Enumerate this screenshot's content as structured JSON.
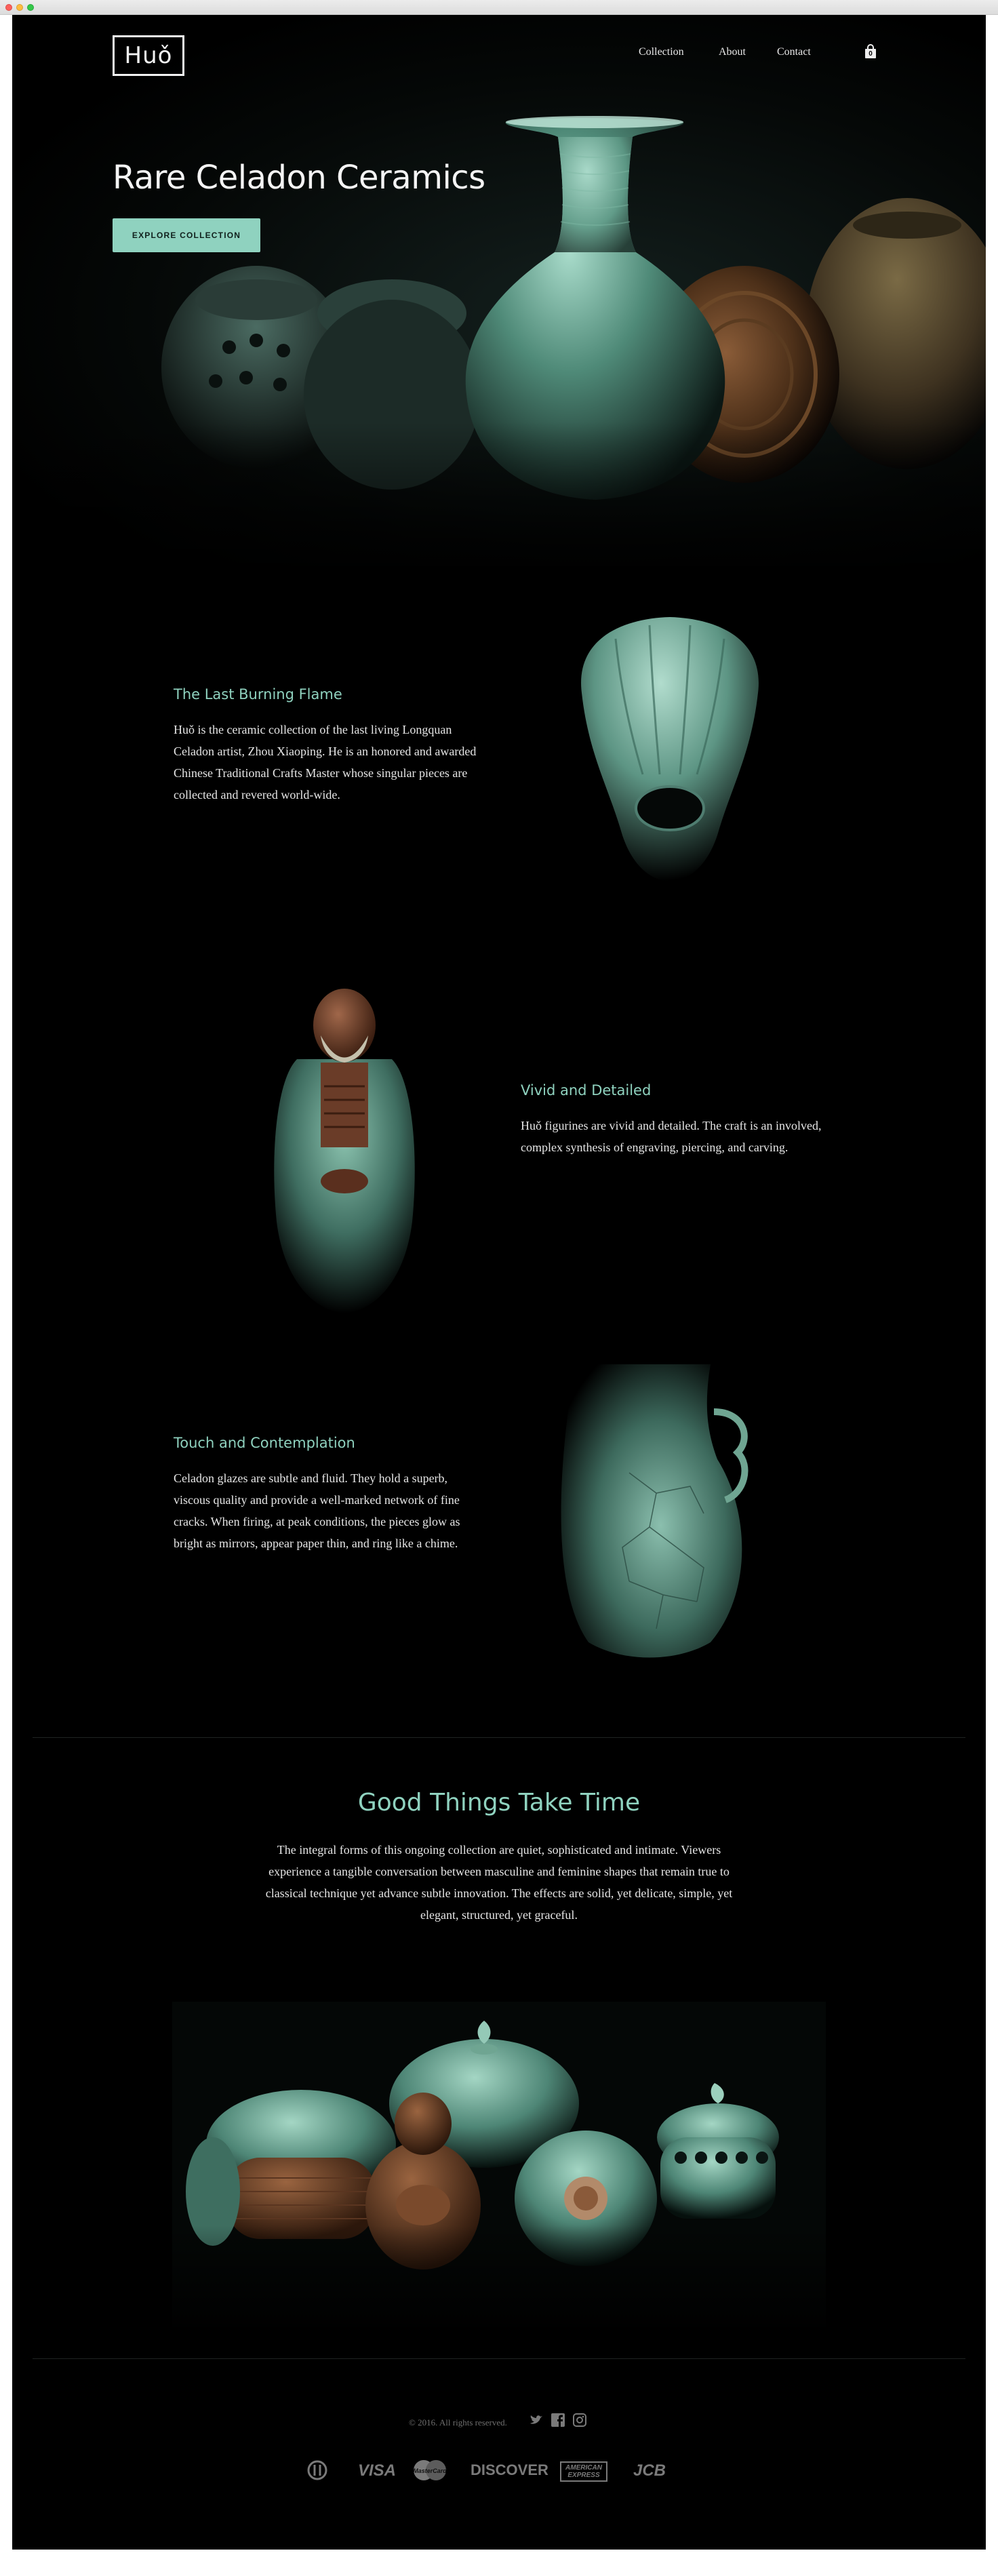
{
  "brand": {
    "logo": "Huǒ"
  },
  "nav": {
    "collection": "Collection",
    "about": "About",
    "contact": "Contact",
    "cart_count": "0"
  },
  "hero": {
    "title": "Rare Celadon Ceramics",
    "button": "EXPLORE COLLECTION"
  },
  "features": [
    {
      "title": "The Last Burning Flame",
      "text": "Huǒ is the ceramic collection of the last living Longquan Celadon artist, Zhou Xiaoping. He is an honored and awarded Chinese Traditional Crafts Master whose singular pieces are collected and revered world-wide."
    },
    {
      "title": "Vivid and Detailed",
      "text": "Huǒ figurines are vivid and detailed. The craft is an involved, complex synthesis of engraving, piercing, and carving."
    },
    {
      "title": "Touch and Contemplation",
      "text": "Celadon glazes are subtle and fluid. They hold a superb, viscous quality and provide a well-marked network of fine cracks. When firing, at peak conditions, the pieces glow as bright as mirrors, appear paper thin, and ring like a chime."
    }
  ],
  "good_things": {
    "title": "Good Things Take Time",
    "text": "The integral forms of this ongoing collection are quiet, sophisticated and intimate. Viewers experience a tangible conversation between masculine and feminine shapes that remain true to classical technique yet advance subtle innovation. The effects are solid, yet delicate, simple, yet elegant, structured, yet graceful."
  },
  "footer": {
    "copyright": "© 2016. All rights reserved.",
    "payments": [
      "Diners",
      "VISA",
      "MasterCard",
      "DISCOVER",
      "AMERICAN EXPRESS",
      "JCB"
    ]
  },
  "colors": {
    "accent": "#8fd2bf",
    "background": "#000000",
    "celadon": "#7fb8a4"
  }
}
